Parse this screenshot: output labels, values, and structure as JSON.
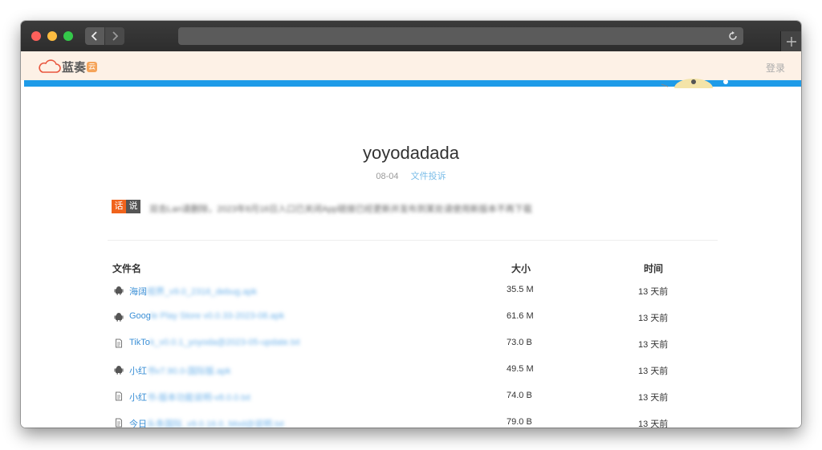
{
  "browser": {
    "back_icon": "chevron-left-icon",
    "forward_icon": "chevron-right-icon",
    "reload_icon": "reload-icon",
    "new_tab_icon": "plus-icon"
  },
  "header": {
    "logo_text": "蓝奏",
    "logo_badge": "云",
    "login_label": "登录",
    "brand_color": "#1e9be8"
  },
  "file": {
    "title": "yoyodadada",
    "date": "08-04",
    "report_label": "文件投诉"
  },
  "notice": {
    "badge_left": "话",
    "badge_right": "说",
    "text": "双击Lan请删除，2023年8月16日入口已关闭App链接已经更新并发布到某处请使用新版本不再下载"
  },
  "table": {
    "headers": {
      "name": "文件名",
      "size": "大小",
      "time": "时间"
    },
    "rows": [
      {
        "icon": "android-icon",
        "name_visible": "海阔",
        "name_blurred": "视界_v9.0_2316_debug.apk",
        "size": "35.5 M",
        "time": "13 天前"
      },
      {
        "icon": "android-icon",
        "name_visible": "Goog",
        "name_blurred": "le Play Store v0.0.33-2023-08.apk",
        "size": "61.6 M",
        "time": "13 天前"
      },
      {
        "icon": "file-icon",
        "name_visible": "TikTo",
        "name_blurred": "k_v0.0.1_yoyoda@2023-05-update.txt",
        "size": "73.0 B",
        "time": "13 天前"
      },
      {
        "icon": "android-icon",
        "name_visible": "小红",
        "name_blurred": "书v7.90.0-国际版.apk",
        "size": "49.5 M",
        "time": "13 天前"
      },
      {
        "icon": "file-icon",
        "name_visible": "小红",
        "name_blurred": "书-版本功能说明-v8.0.0.txt",
        "size": "74.0 B",
        "time": "13 天前"
      },
      {
        "icon": "file-icon",
        "name_visible": "今日",
        "name_blurred": "头条国际_v9.0.16.0_Mod@说明.txt",
        "size": "79.0 B",
        "time": "13 天前"
      }
    ]
  }
}
